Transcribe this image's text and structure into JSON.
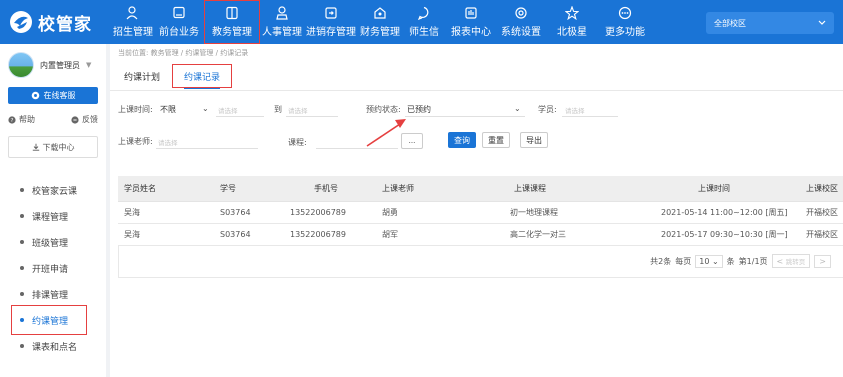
{
  "brand": {
    "name": "校管家",
    "color": "#1a74d6"
  },
  "nav": [
    {
      "label": "招生管理",
      "icon": "user-add-icon"
    },
    {
      "label": "前台业务",
      "icon": "monitor-icon"
    },
    {
      "label": "教务管理",
      "icon": "book-icon",
      "active": true
    },
    {
      "label": "人事管理",
      "icon": "person-icon"
    },
    {
      "label": "进销存管理",
      "icon": "inventory-icon"
    },
    {
      "label": "财务管理",
      "icon": "finance-icon"
    },
    {
      "label": "师生信",
      "icon": "chat-icon"
    },
    {
      "label": "报表中心",
      "icon": "report-icon"
    },
    {
      "label": "系统设置",
      "icon": "settings-icon"
    },
    {
      "label": "北极星",
      "icon": "star-icon"
    },
    {
      "label": "更多功能",
      "icon": "more-icon"
    }
  ],
  "campus_select": "全部校区",
  "sidebar": {
    "user_name": "内置管理员",
    "service": "在线客服",
    "help": "帮助",
    "feedback": "反馈",
    "download": "下载中心",
    "menu": [
      "校管家云课",
      "课程管理",
      "班级管理",
      "开班申请",
      "排课管理",
      "约课管理",
      "课表和点名"
    ],
    "active_menu": "约课管理"
  },
  "breadcrumb": "当前位置: 教务管理 / 约课管理 / 约课记录",
  "tabs": [
    "约课计划",
    "约课记录"
  ],
  "active_tab": "约课记录",
  "filters": {
    "time_label": "上课时间:",
    "time_value": "不限",
    "time_placeholder": "请选择",
    "to_label": "到",
    "to_placeholder": "请选择",
    "status_label": "预约状态:",
    "status_value": "已预约",
    "student_label": "学员:",
    "student_placeholder": "请选择",
    "teacher_label": "上课老师:",
    "teacher_placeholder": "请选择",
    "course_label": "课程:",
    "ellipsis": "...",
    "query": "查询",
    "reset": "重置",
    "export": "导出"
  },
  "table": {
    "headers": [
      "学员姓名",
      "学号",
      "手机号",
      "上课老师",
      "上课课程",
      "上课时间",
      "上课校区"
    ],
    "rows": [
      [
        "吴海",
        "S03764",
        "13522006789",
        "胡勇",
        "初一地理课程",
        "2021-05-14 11:00~12:00 [周五]",
        "开福校区"
      ],
      [
        "吴海",
        "S03764",
        "13522006789",
        "胡军",
        "高二化学一对三",
        "2021-05-17 09:30~10:30 [周一]",
        "开福校区"
      ]
    ]
  },
  "pager": {
    "total": "共2条",
    "per_page_label": "每页",
    "per_page": "10",
    "unit": "条",
    "page": "第1/1页",
    "jump_placeholder": "跳转页"
  }
}
